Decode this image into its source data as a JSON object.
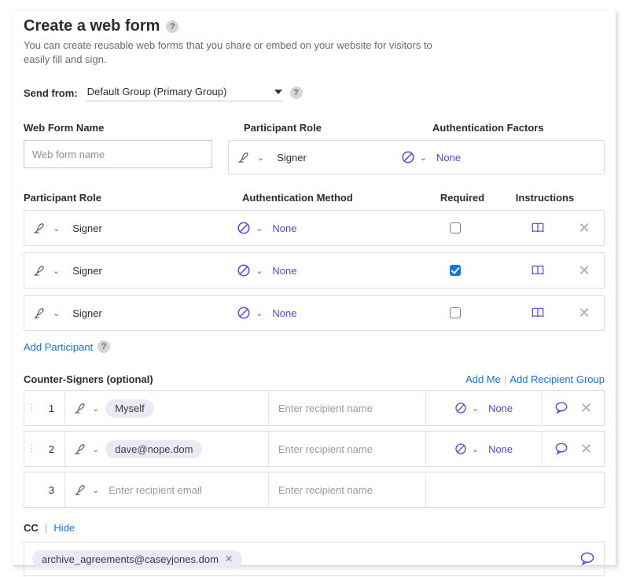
{
  "title": "Create a web form",
  "subtitle": "You can create reusable web forms that you share or embed on your website for visitors to easily fill and sign.",
  "send_from": {
    "label": "Send from:",
    "value": "Default Group (Primary Group)"
  },
  "section1": {
    "web_form_name_label": "Web Form Name",
    "web_form_name_placeholder": "Web form name",
    "participant_role_label": "Participant Role",
    "auth_factors_label": "Authentication Factors",
    "role_value": "Signer",
    "auth_value": "None"
  },
  "section2": {
    "headers": {
      "role": "Participant Role",
      "auth": "Authentication Method",
      "required": "Required",
      "instructions": "Instructions"
    },
    "rows": [
      {
        "role": "Signer",
        "auth": "None",
        "required": false
      },
      {
        "role": "Signer",
        "auth": "None",
        "required": true
      },
      {
        "role": "Signer",
        "auth": "None",
        "required": false
      }
    ],
    "add_participant": "Add Participant"
  },
  "counter": {
    "title": "Counter-Signers (optional)",
    "add_me": "Add Me",
    "add_group": "Add Recipient Group",
    "name_placeholder": "Enter recipient name",
    "email_placeholder": "Enter recipient email",
    "auth_value": "None",
    "rows": [
      {
        "num": "1",
        "chip": "Myself",
        "has_auth": true
      },
      {
        "num": "2",
        "chip": "dave@nope.dom",
        "has_auth": true
      },
      {
        "num": "3",
        "chip": "",
        "has_auth": false
      }
    ]
  },
  "cc": {
    "label": "CC",
    "hide": "Hide",
    "chip": "archive_agreements@caseyjones.dom"
  }
}
